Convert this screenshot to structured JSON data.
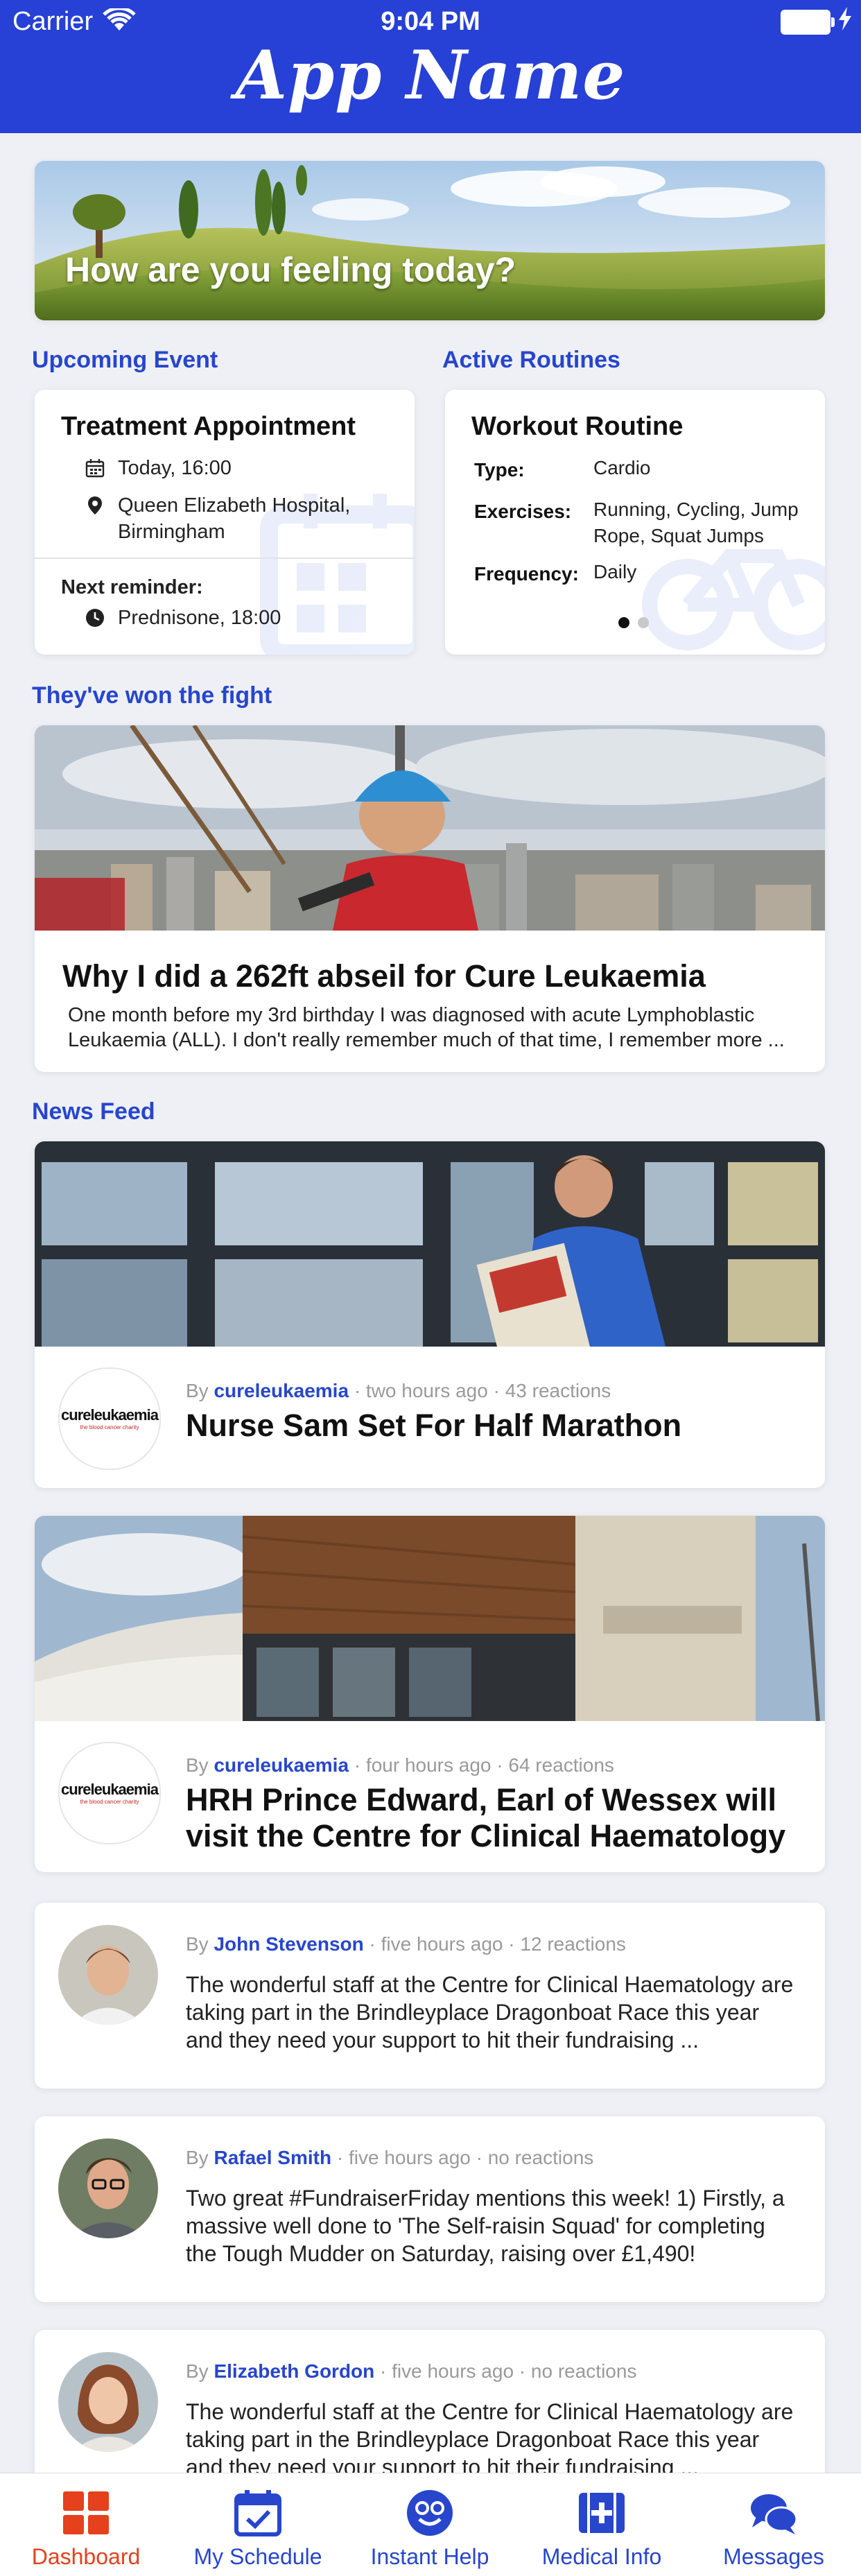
{
  "status": {
    "carrier": "Carrier",
    "time": "9:04 PM"
  },
  "app_title": "App Name",
  "hero": {
    "text": "How are you feeling today?"
  },
  "upcoming": {
    "label": "Upcoming Event",
    "title": "Treatment Appointment",
    "time": "Today, 16:00",
    "location": "Queen Elizabeth Hospital, Birmingham",
    "reminder_label": "Next reminder:",
    "reminder_value": "Prednisone, 18:00"
  },
  "routines": {
    "label": "Active Routines",
    "title": "Workout Routine",
    "rows": [
      {
        "label": "Type:",
        "value": "Cardio"
      },
      {
        "label": "Exercises:",
        "value": "Running, Cycling, Jump Rope, Squat Jumps"
      },
      {
        "label": "Frequency:",
        "value": "Daily"
      }
    ],
    "page_count": 2,
    "active_page": 1
  },
  "stories": {
    "label": "They've won the fight",
    "title": "Why I did a 262ft abseil for Cure Leukaemia",
    "body": "One month before my 3rd birthday I was diagnosed with acute Lymphoblastic Leukaemia (ALL). I don't really remember much of that time, I remember more ..."
  },
  "news": {
    "label": "News Feed",
    "by": "By",
    "logo_text_a": "cure",
    "logo_text_b": "leukaemia",
    "logo_tag": "the blood cancer charity",
    "items": [
      {
        "author": "cureleukaemia",
        "meta": " · two hours ago · 43 reactions",
        "title": "Nurse Sam Set For Half Marathon"
      },
      {
        "author": "cureleukaemia",
        "meta": " · four hours ago · 64 reactions",
        "title": "HRH Prince Edward, Earl of Wessex will visit the Centre for Clinical Haematology"
      },
      {
        "author": "John Stevenson",
        "meta": " · five hours ago · 12 reactions",
        "body": "The wonderful staff at the Centre for Clinical Haematology are taking part in the Brindleyplace Dragonboat Race this year and they need your support to hit their fundraising ..."
      },
      {
        "author": "Rafael Smith",
        "meta": " · five hours ago · no reactions",
        "body": "Two great #FundraiserFriday mentions this week! 1) Firstly, a massive well done to 'The Self-raisin Squad' for completing the Tough Mudder on Saturday, raising over £1,490!"
      },
      {
        "author": "Elizabeth Gordon",
        "meta": " · five hours ago · no reactions",
        "body": "The wonderful staff at the Centre for Clinical Haematology are taking part in the Brindleyplace Dragonboat Race this year and they need your support to hit their fundraising ..."
      }
    ]
  },
  "tabs": [
    {
      "label": "Dashboard",
      "icon": "dashboard-icon",
      "active": true
    },
    {
      "label": "My Schedule",
      "icon": "calendar-check-icon",
      "active": false
    },
    {
      "label": "Instant Help",
      "icon": "smiley-icon",
      "active": false
    },
    {
      "label": "Medical Info",
      "icon": "medical-cross-icon",
      "active": false
    },
    {
      "label": "Messages",
      "icon": "chat-bubbles-icon",
      "active": false
    }
  ],
  "colors": {
    "primary": "#2740d6",
    "link": "#2746cc",
    "active_tab": "#e4411c",
    "background": "#eef0f6"
  }
}
